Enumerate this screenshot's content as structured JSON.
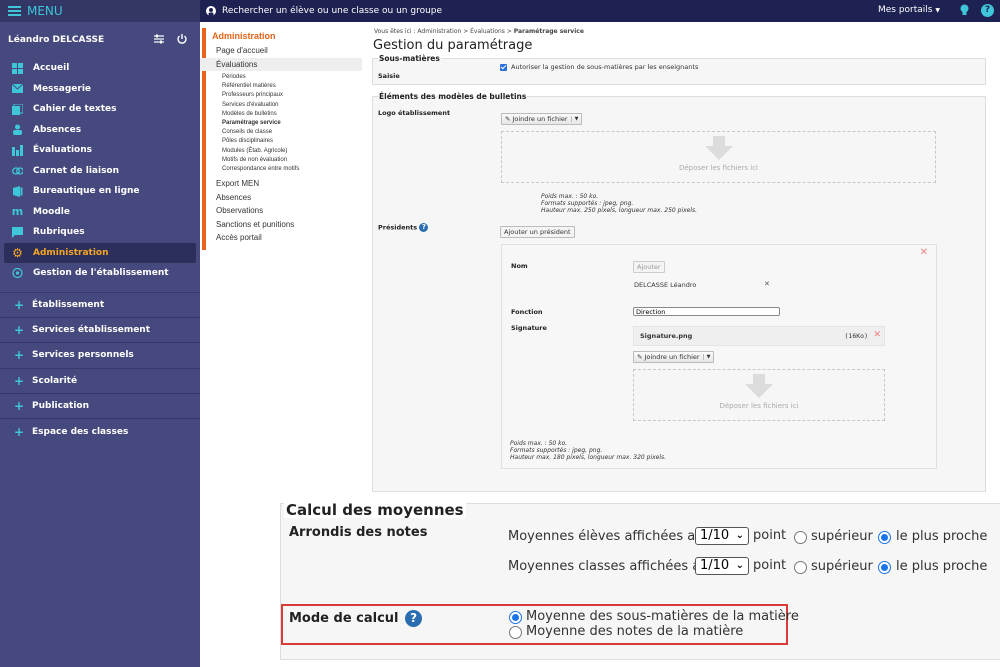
{
  "sidebar": {
    "menu_label": "MENU",
    "user_name": "Léandro DELCASSE",
    "nav_items": [
      {
        "label": "Accueil",
        "icon": "grid-icon"
      },
      {
        "label": "Messagerie",
        "icon": "envelope-icon"
      },
      {
        "label": "Cahier de textes",
        "icon": "notebook-icon"
      },
      {
        "label": "Absences",
        "icon": "person-icon"
      },
      {
        "label": "Évaluations",
        "icon": "bar-chart-icon"
      },
      {
        "label": "Carnet de liaison",
        "icon": "link-icon"
      },
      {
        "label": "Bureautique en ligne",
        "icon": "office-icon"
      },
      {
        "label": "Moodle",
        "icon": "moodle-icon"
      },
      {
        "label": "Rubriques",
        "icon": "chat-icon"
      },
      {
        "label": "Administration",
        "icon": "gear-icon",
        "active": true
      },
      {
        "label": "Gestion de l'établissement",
        "icon": "location-icon"
      }
    ],
    "groups": [
      "Établissement",
      "Services établissement",
      "Services personnels",
      "Scolarité",
      "Publication",
      "Espace des classes"
    ]
  },
  "topbar": {
    "search_placeholder": "Rechercher un élève ou une classe ou un groupe",
    "portals_label": "Mes portails",
    "help_label": "?"
  },
  "adminnav": {
    "title": "Administration",
    "items_top": [
      "Page d'accueil",
      "Évaluations"
    ],
    "sub_items": [
      "Périodes",
      "Référentiel matières",
      "Professeurs principaux",
      "Services d'évaluation",
      "Modèles de bulletins",
      "Paramétrage service",
      "Conseils de classe",
      "Pôles disciplinaires",
      "Modules (Étab. Agricole)",
      "Motifs de non évaluation",
      "Correspondance entre motifs"
    ],
    "current_sub": "Paramétrage service",
    "items_bottom": [
      "Export MEN",
      "Absences",
      "Observations",
      "Sanctions et punitions",
      "Accès portail"
    ]
  },
  "main": {
    "breadcrumb_prefix": "Vous êtes ici : Administration > Évaluations > ",
    "breadcrumb_current": "Paramétrage service",
    "title": "Gestion du paramétrage",
    "sous_matieres": {
      "legend": "Sous-matières",
      "label": "Saisie",
      "checkbox_label": "Autoriser la gestion de sous-matières par les enseignants",
      "checked": true
    },
    "elements": {
      "legend": "Éléments des modèles de bulletins",
      "logo_label": "Logo établissement",
      "attach_label": "Joindre un fichier",
      "drop_label": "Déposer les fichiers ici",
      "logo_hints": [
        "Poids max. : 50 ko.",
        "Formats supportés : jpeg, png.",
        "Hauteur max. 250 pixels, longueur max. 250 pixels."
      ],
      "presidents_label": "Présidents",
      "add_president_label": "Ajouter un président",
      "nom_label": "Nom",
      "ajouter_label": "Ajouter",
      "president_name": "DELCASSE Léandro",
      "fonction_label": "Fonction",
      "fonction_value": "Direction",
      "signature_label": "Signature",
      "signature_file": "Signature.png",
      "signature_size": "(16Ko)",
      "signature_hints": [
        "Poids max. : 50 ko.",
        "Formats supportés : jpeg, png.",
        "Hauteur max. 180 pixels, longueur max. 320 pixels."
      ]
    },
    "calcul": {
      "legend": "Calcul des moyennes",
      "arrondis_label": "Arrondis des notes",
      "row1_text": "Moyennes élèves affichées au",
      "row2_text": "Moyennes classes affichées au",
      "select_value": "1/10",
      "point_label": "point",
      "option_superieur": "supérieur",
      "option_proche": "le plus proche",
      "row1_selected": "le plus proche",
      "row2_selected": "le plus proche",
      "mode_label": "Mode de calcul",
      "mode_options": [
        "Moyenne des sous-matières de la matière",
        "Moyenne des notes de la matière"
      ],
      "mode_selected": "Moyenne des sous-matières de la matière"
    }
  },
  "colors": {
    "sidebar_bg": "#46497e",
    "topbar_bg": "#1e2252",
    "accent_cyan": "#3fc6d8",
    "active_orange": "#f5a623",
    "admin_orange": "#e8641b",
    "highlight_red": "#d93a3a"
  }
}
